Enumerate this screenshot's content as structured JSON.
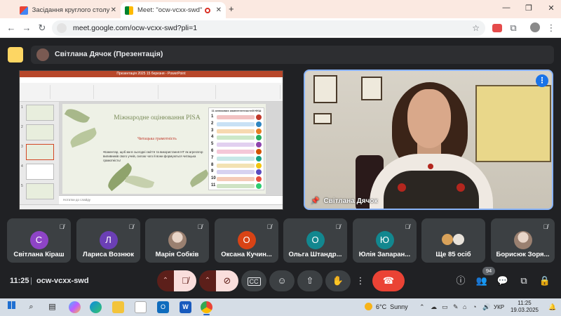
{
  "browser": {
    "tabs": [
      {
        "title": "Засідання круглого столу з ел",
        "active": false,
        "favicon": "gmail-icon"
      },
      {
        "title": "Meet: \"ocw-vcxx-swd\"",
        "active": true,
        "favicon": "meet-icon"
      }
    ],
    "new_tab": "+",
    "url": "meet.google.com/ocw-vcxx-swd?pli=1"
  },
  "meet": {
    "presenter_banner": "Світлана Дячок (Презентація)",
    "presentation": {
      "app_title": "Презентація 2025 15 березня - PowerPoint",
      "slide_title": "Міжнародне оцінювання PISA",
      "slide_subtitle": "Читацька грамотність",
      "slide_body": "•Коментар, щоб ми в сьогодні сміття та використання НТ як агрегатор виливників свого учнів, силою чого й вони формуються читацька грамотність!",
      "list_head": "11 ключових компетентностей НУШ",
      "list_numbers": [
        "1",
        "2",
        "3",
        "4",
        "5",
        "6",
        "7",
        "8",
        "9",
        "10",
        "11"
      ],
      "notes_placeholder": "Нотатки до слайду",
      "thumbnail_numbers": [
        "1",
        "2",
        "3",
        "4",
        "5"
      ]
    },
    "speaker": {
      "name": "Світлана Дячок"
    },
    "participants": [
      {
        "name": "Світлана Кіраш",
        "initial": "С",
        "color": "#8e44c6"
      },
      {
        "name": "Лариса Вознюк",
        "initial": "Л",
        "color": "#6b3fb5"
      },
      {
        "name": "Марія Собків",
        "initial": "",
        "color": "#9a8070"
      },
      {
        "name": "Оксана Кучин...",
        "initial": "О",
        "color": "#d84315"
      },
      {
        "name": "Ольга Штандр...",
        "initial": "О",
        "color": "#12878f"
      },
      {
        "name": "Юлія Запаран...",
        "initial": "Ю",
        "color": "#12878f"
      },
      {
        "name": "Ще 85 осіб",
        "initial": "",
        "color": "#3c4043"
      },
      {
        "name": "Борисюк Зоря...",
        "initial": "",
        "color": "#9a8070"
      }
    ],
    "controls": {
      "time": "11:25",
      "separator": "|",
      "meeting_code": "ocw-vcxx-swd",
      "people_count": "94"
    }
  },
  "taskbar": {
    "weather_temp": "6°C",
    "weather_text": "Sunny",
    "language": "УКР",
    "clock_time": "11:25",
    "clock_date": "19.03.2025"
  }
}
